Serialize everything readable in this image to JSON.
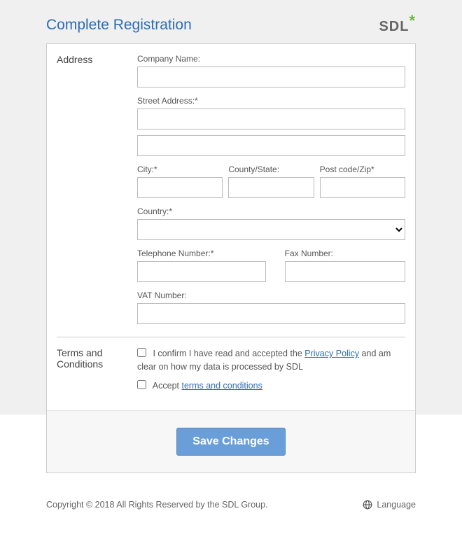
{
  "header": {
    "title": "Complete Registration",
    "logo_text": "SDL",
    "logo_star": "*"
  },
  "sections": {
    "address_label": "Address",
    "terms_label": "Terms and Conditions"
  },
  "fields": {
    "company_name_label": "Company Name:",
    "street_label": "Street Address:*",
    "city_label": "City:*",
    "county_label": "County/State:",
    "postcode_label": "Post code/Zip*",
    "country_label": "Country:*",
    "telephone_label": "Telephone Number:*",
    "fax_label": "Fax Number:",
    "vat_label": "VAT Number:",
    "company_name_value": "",
    "street1_value": "",
    "street2_value": "",
    "city_value": "",
    "county_value": "",
    "postcode_value": "",
    "country_value": "",
    "telephone_value": "",
    "fax_value": "",
    "vat_value": ""
  },
  "terms": {
    "privacy_prefix": "I confirm I have read and accepted the ",
    "privacy_link": "Privacy Policy",
    "privacy_suffix": " and am clear on how my data is processed by SDL",
    "accept_prefix": "Accept ",
    "accept_link": "terms and conditions"
  },
  "buttons": {
    "save": "Save Changes"
  },
  "footer": {
    "copyright": "Copyright © 2018 All Rights Reserved by the SDL Group.",
    "language": "Language"
  }
}
